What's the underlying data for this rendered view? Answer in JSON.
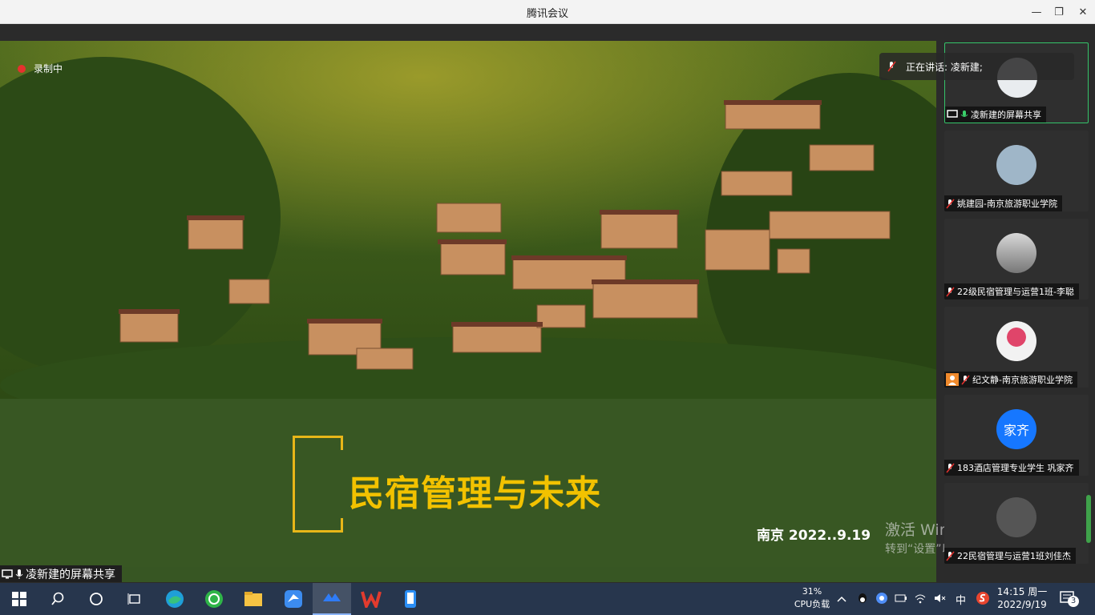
{
  "window": {
    "title": "腾讯会议",
    "min_label": "—",
    "max_label": "❐",
    "close_label": "✕"
  },
  "recording": {
    "label": "录制中"
  },
  "slide": {
    "title": "民宿管理与未来",
    "subtitle": "南京  2022..9.19"
  },
  "share_label": "凌新建的屏幕共享",
  "speaking": {
    "label": "正在讲话: 凌新建;"
  },
  "watermark": {
    "line1": "激活 Windows",
    "line2": "转到“设置”以激活 Windows"
  },
  "participants": [
    {
      "name": "凌新建的屏幕共享",
      "muted": false,
      "active": true
    },
    {
      "name": "姚建园-南京旅游职业学院",
      "muted": true
    },
    {
      "name": "22级民宿管理与运营1班-李聪",
      "muted": true
    },
    {
      "name": "纪文静-南京旅游职业学院",
      "muted": true
    },
    {
      "name": "183酒店管理专业学生 巩家齐",
      "muted": true,
      "avatar_text": "家齐"
    },
    {
      "name": "22民宿管理与运营1班刘佳杰",
      "muted": true
    }
  ],
  "taskbar": {
    "cpu_percent": "31%",
    "cpu_label": "CPU负载",
    "ime": "中",
    "time": "14:15 周一",
    "date": "2022/9/19",
    "notification_count": "3"
  },
  "colors": {
    "slide_green": "#385723",
    "title_yellow": "#f2c200",
    "taskbar": "#27364d",
    "active_border": "#35c46a"
  }
}
